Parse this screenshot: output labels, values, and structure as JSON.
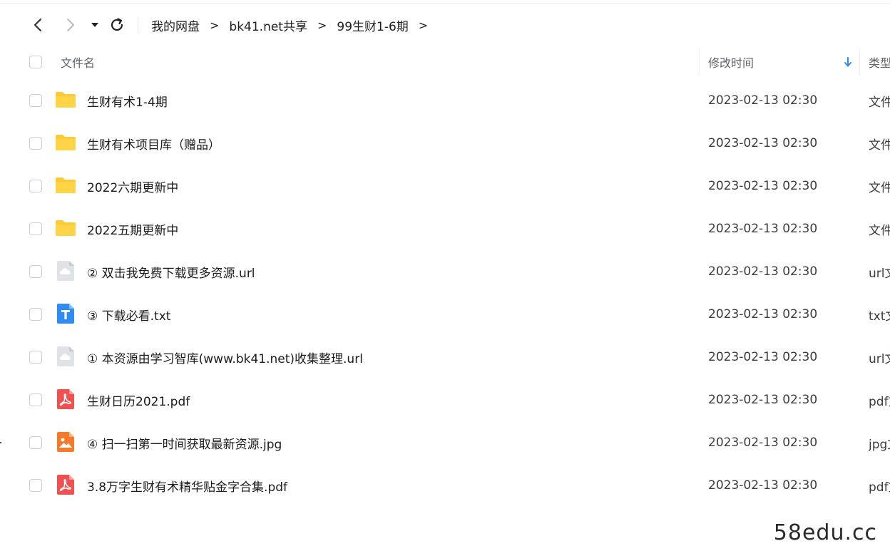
{
  "breadcrumb": [
    "我的网盘",
    "bk41.net共享",
    "99生财1-6期"
  ],
  "breadcrumb_separator": ">",
  "header": {
    "name": "文件名",
    "modified": "修改时间",
    "type": "类型"
  },
  "files": [
    {
      "name": "生财有术1-4期",
      "time": "2023-02-13 02:30",
      "type": "文件夹",
      "icon": "folder-icon"
    },
    {
      "name": "生财有术项目库（赠品）",
      "time": "2023-02-13 02:30",
      "type": "文件夹",
      "icon": "folder-icon"
    },
    {
      "name": "2022六期更新中",
      "time": "2023-02-13 02:30",
      "type": "文件夹",
      "icon": "folder-icon"
    },
    {
      "name": "2022五期更新中",
      "time": "2023-02-13 02:30",
      "type": "文件夹",
      "icon": "folder-icon"
    },
    {
      "name": "② 双击我免费下载更多资源.url",
      "time": "2023-02-13 02:30",
      "type": "url文件",
      "icon": "url-file-icon"
    },
    {
      "name": "③ 下载必看.txt",
      "time": "2023-02-13 02:30",
      "type": "txt文件",
      "icon": "txt-file-icon"
    },
    {
      "name": "① 本资源由学习智库(www.bk41.net)收集整理.url",
      "time": "2023-02-13 02:30",
      "type": "url文件",
      "icon": "url-file-icon"
    },
    {
      "name": "生财日历2021.pdf",
      "time": "2023-02-13 02:30",
      "type": "pdf文件",
      "icon": "pdf-file-icon"
    },
    {
      "name": "④ 扫一扫第一时间获取最新资源.jpg",
      "time": "2023-02-13 02:30",
      "type": "jpg文件",
      "icon": "image-file-icon"
    },
    {
      "name": "3.8万字生财有术精华贴金字合集.pdf",
      "time": "2023-02-13 02:30",
      "type": "pdf文件",
      "icon": "pdf-file-icon"
    }
  ],
  "watermark": "58edu.cc",
  "colors": {
    "folder": "#ffc933",
    "txt": "#2f8cf5",
    "pdf": "#f0504f",
    "image": "#f57b2a",
    "url": "#dfe2e6",
    "sort_arrow": "#2a8cf0"
  }
}
